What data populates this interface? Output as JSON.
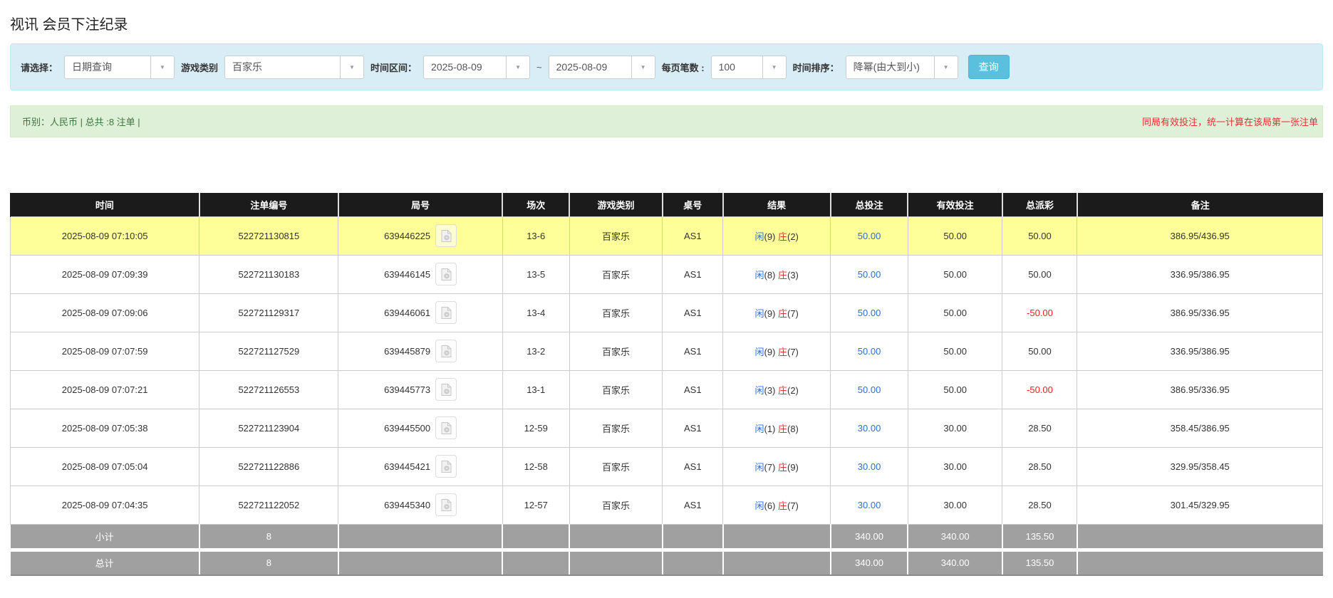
{
  "title": "视讯 会员下注纪录",
  "icons": {
    "dropdown_arrow": "▼"
  },
  "filters": {
    "select_label": "请选择：",
    "select_value": "日期查询",
    "game_label": "游戏类别",
    "game_value": "百家乐",
    "range_label": "时间区间：",
    "date_from": "2025-08-09",
    "range_separator": "~",
    "date_to": "2025-08-09",
    "page_size_label": "每页笔数 :",
    "page_size_value": "100",
    "sort_label": "时间排序：",
    "sort_value": "降幂(由大到小)",
    "search_button": "查询"
  },
  "summary": {
    "left": "币别：人民币 | 总共 :8 注单 |",
    "notice": "同局有效投注，统一计算在该局第一张注单"
  },
  "table": {
    "columns": [
      "时间",
      "注单编号",
      "局号",
      "场次",
      "游戏类别",
      "桌号",
      "结果",
      "总投注",
      "有效投注",
      "总派彩",
      "备注"
    ],
    "result_labels": {
      "player": "闲",
      "banker": "庄"
    },
    "rows": [
      {
        "time": "2025-08-09 07:10:05",
        "bet_id": "522721130815",
        "round": "639446225",
        "session": "13-6",
        "game": "百家乐",
        "table_no": "AS1",
        "result": {
          "player": "9",
          "banker": "2"
        },
        "total_bet": "50.00",
        "valid_bet": "50.00",
        "payout": "50.00",
        "note": "386.95/436.95",
        "highlight": true
      },
      {
        "time": "2025-08-09 07:09:39",
        "bet_id": "522721130183",
        "round": "639446145",
        "session": "13-5",
        "game": "百家乐",
        "table_no": "AS1",
        "result": {
          "player": "8",
          "banker": "3"
        },
        "total_bet": "50.00",
        "valid_bet": "50.00",
        "payout": "50.00",
        "note": "336.95/386.95",
        "highlight": false
      },
      {
        "time": "2025-08-09 07:09:06",
        "bet_id": "522721129317",
        "round": "639446061",
        "session": "13-4",
        "game": "百家乐",
        "table_no": "AS1",
        "result": {
          "player": "9",
          "banker": "7"
        },
        "total_bet": "50.00",
        "valid_bet": "50.00",
        "payout": "-50.00",
        "note": "386.95/336.95",
        "highlight": false
      },
      {
        "time": "2025-08-09 07:07:59",
        "bet_id": "522721127529",
        "round": "639445879",
        "session": "13-2",
        "game": "百家乐",
        "table_no": "AS1",
        "result": {
          "player": "9",
          "banker": "7"
        },
        "total_bet": "50.00",
        "valid_bet": "50.00",
        "payout": "50.00",
        "note": "336.95/386.95",
        "highlight": false
      },
      {
        "time": "2025-08-09 07:07:21",
        "bet_id": "522721126553",
        "round": "639445773",
        "session": "13-1",
        "game": "百家乐",
        "table_no": "AS1",
        "result": {
          "player": "3",
          "banker": "2"
        },
        "total_bet": "50.00",
        "valid_bet": "50.00",
        "payout": "-50.00",
        "note": "386.95/336.95",
        "highlight": false
      },
      {
        "time": "2025-08-09 07:05:38",
        "bet_id": "522721123904",
        "round": "639445500",
        "session": "12-59",
        "game": "百家乐",
        "table_no": "AS1",
        "result": {
          "player": "1",
          "banker": "8"
        },
        "total_bet": "30.00",
        "valid_bet": "30.00",
        "payout": "28.50",
        "note": "358.45/386.95",
        "highlight": false
      },
      {
        "time": "2025-08-09 07:05:04",
        "bet_id": "522721122886",
        "round": "639445421",
        "session": "12-58",
        "game": "百家乐",
        "table_no": "AS1",
        "result": {
          "player": "7",
          "banker": "9"
        },
        "total_bet": "30.00",
        "valid_bet": "30.00",
        "payout": "28.50",
        "note": "329.95/358.45",
        "highlight": false
      },
      {
        "time": "2025-08-09 07:04:35",
        "bet_id": "522721122052",
        "round": "639445340",
        "session": "12-57",
        "game": "百家乐",
        "table_no": "AS1",
        "result": {
          "player": "6",
          "banker": "7"
        },
        "total_bet": "30.00",
        "valid_bet": "30.00",
        "payout": "28.50",
        "note": "301.45/329.95",
        "highlight": false
      }
    ],
    "subtotal": {
      "label": "小计",
      "count": "8",
      "total_bet": "340.00",
      "valid_bet": "340.00",
      "payout": "135.50"
    },
    "total": {
      "label": "总计",
      "count": "8",
      "total_bet": "340.00",
      "valid_bet": "340.00",
      "payout": "135.50"
    }
  }
}
